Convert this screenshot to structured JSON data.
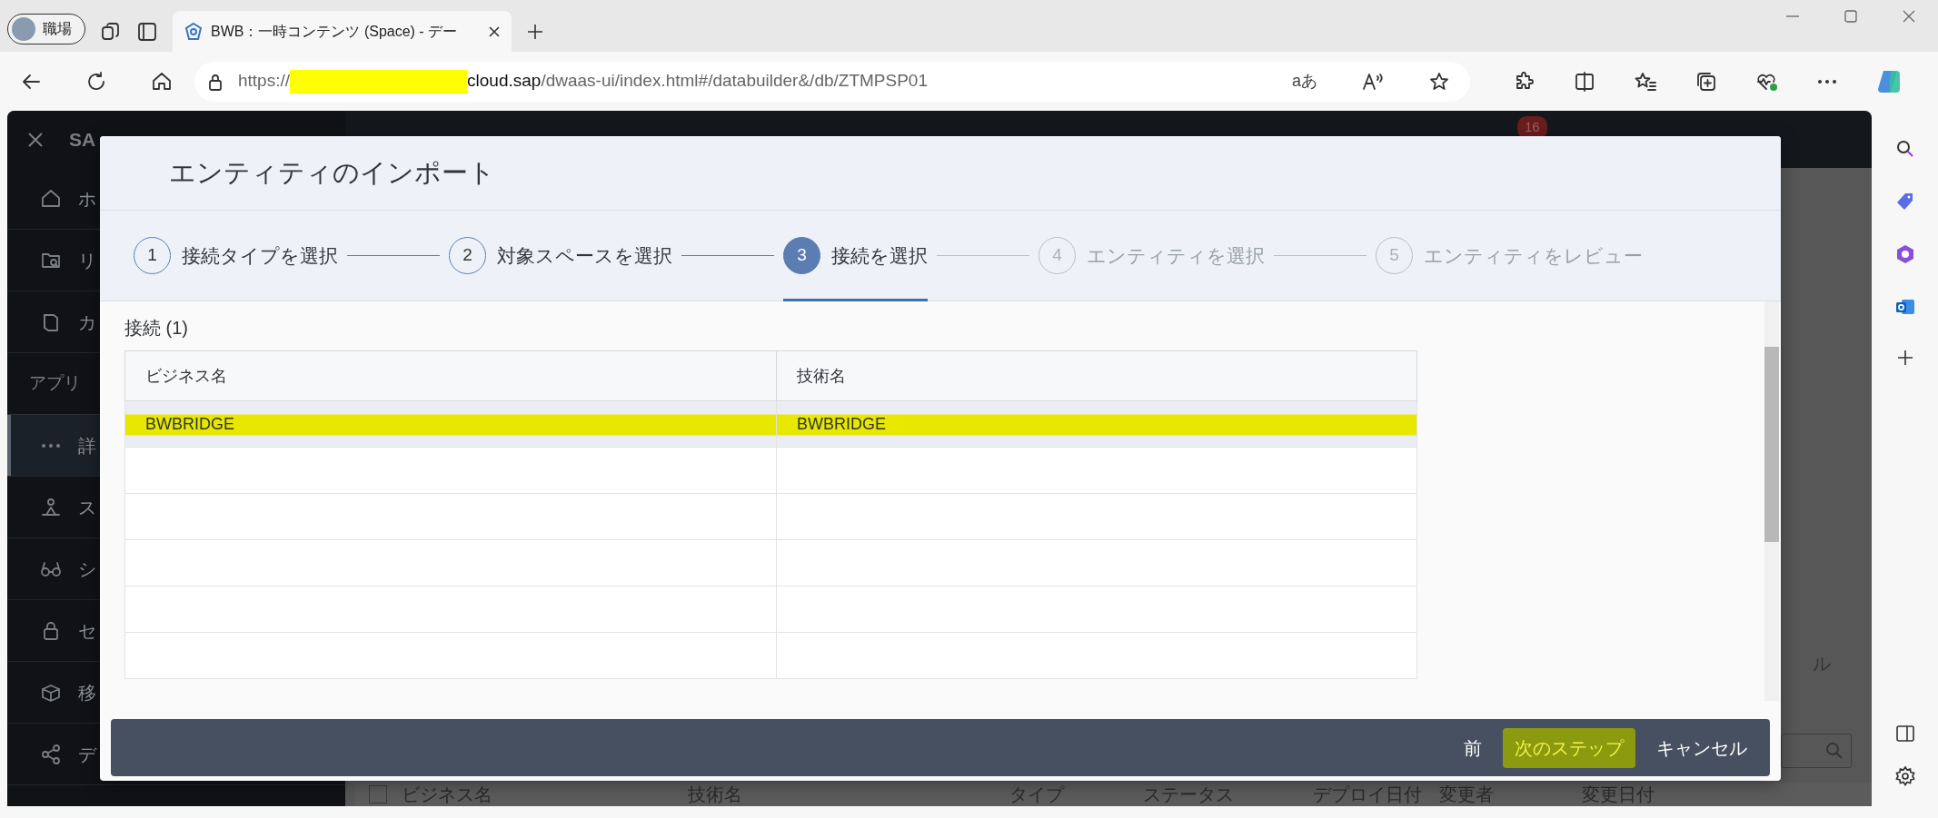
{
  "browser": {
    "profile": {
      "label": "職場"
    },
    "tabs": [
      {
        "title": "BWB：一時コンテンツ (Space) - デー",
        "selected": true
      }
    ],
    "address": {
      "scheme": "https://",
      "redacted": true,
      "host": "cloud.sap",
      "path": "/dwaas-ui/index.html#/databuilder&/db/ZTMPSP01"
    },
    "translate_label": "aあ"
  },
  "app": {
    "header": {
      "title": "SA",
      "badge": "16"
    },
    "sidebar": {
      "items": [
        {
          "kind": "item",
          "label": "ホ",
          "selected": false
        },
        {
          "kind": "item",
          "label": "リ",
          "selected": false
        },
        {
          "kind": "item",
          "label": "カ",
          "selected": false
        },
        {
          "kind": "section",
          "label": "アプリ"
        },
        {
          "kind": "item",
          "label": "詳",
          "selected": true
        },
        {
          "kind": "item",
          "label": "ス",
          "selected": false
        },
        {
          "kind": "item",
          "label": "シ",
          "selected": false
        },
        {
          "kind": "item",
          "label": "セ",
          "selected": false
        },
        {
          "kind": "item",
          "label": "移",
          "selected": false
        },
        {
          "kind": "item",
          "label": "デ",
          "selected": false
        }
      ]
    },
    "page": {
      "side_label": "ル",
      "header_checkbox": {
        "checked": false
      },
      "table_columns": [
        "ビジネス名",
        "技術名",
        "タイプ",
        "ステータス",
        "デプロイ日付",
        "変更者",
        "変更日付"
      ]
    }
  },
  "dialog": {
    "title": "エンティティのインポート",
    "steps": [
      {
        "number": "1",
        "label": "接続タイプを選択",
        "selected": false,
        "disabled": false
      },
      {
        "number": "2",
        "label": "対象スペースを選択",
        "selected": false,
        "disabled": false
      },
      {
        "number": "3",
        "label": "接続を選択",
        "selected": true,
        "disabled": false
      },
      {
        "number": "4",
        "label": "エンティティを選択",
        "selected": false,
        "disabled": true
      },
      {
        "number": "5",
        "label": "エンティティをレビュー",
        "selected": false,
        "disabled": true
      }
    ],
    "section_title": "接続 (1)",
    "table": {
      "columns": [
        "ビジネス名",
        "技術名"
      ],
      "rows": [
        {
          "cells": [
            "BWBRIDGE",
            "BWBRIDGE"
          ],
          "selected": true,
          "annotated": true
        }
      ]
    },
    "buttons": [
      {
        "label": "前",
        "kind": "transparent",
        "annotated": false
      },
      {
        "label": "次のステップ",
        "kind": "emphasized",
        "annotated": true
      },
      {
        "label": "キャンセル",
        "kind": "transparent",
        "annotated": false
      }
    ]
  }
}
